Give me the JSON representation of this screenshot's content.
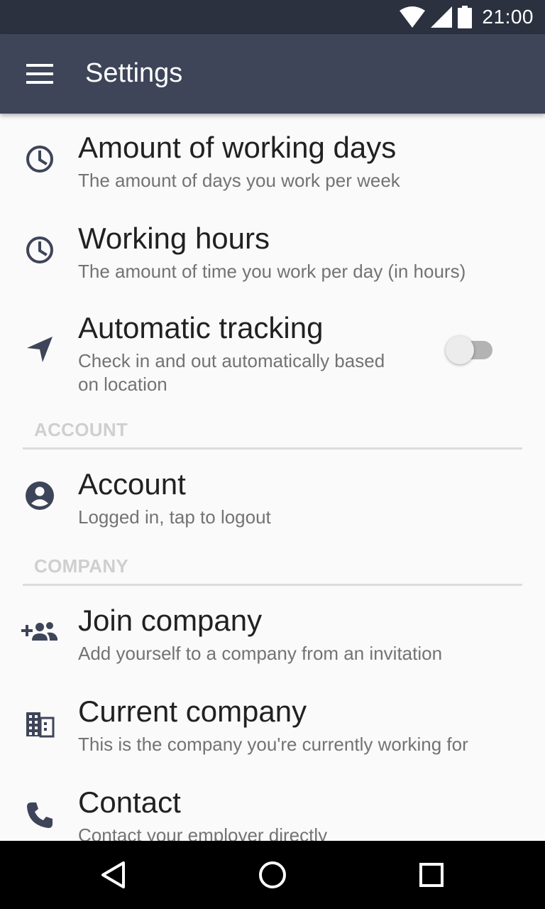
{
  "status_bar": {
    "time": "21:00",
    "icons": [
      "wifi-icon",
      "cell-signal-icon",
      "battery-icon"
    ]
  },
  "app_bar": {
    "title": "Settings",
    "menu_icon": "hamburger-menu-icon"
  },
  "preferences": [
    {
      "icon": "clock-icon",
      "title": "Amount of working days",
      "summary": "The amount of days you work per week"
    },
    {
      "icon": "clock-icon",
      "title": "Working hours",
      "summary": "The amount of time you work per day (in hours)"
    },
    {
      "icon": "navigation-arrow-icon",
      "title": "Automatic tracking",
      "summary_lines": [
        "Check in and out automatically based",
        "on location"
      ],
      "toggle": {
        "state": "off"
      }
    }
  ],
  "sections": [
    {
      "header": "ACCOUNT",
      "items": [
        {
          "icon": "account-circle-icon",
          "title": "Account",
          "summary": "Logged in, tap to logout"
        }
      ]
    },
    {
      "header": "COMPANY",
      "items": [
        {
          "icon": "group-add-icon",
          "title": "Join company",
          "summary": "Add yourself to a company from an invitation"
        },
        {
          "icon": "business-building-icon",
          "title": "Current company",
          "summary": "This is the company you're currently working for"
        },
        {
          "icon": "phone-icon",
          "title": "Contact",
          "summary": "Contact your employer directly"
        }
      ]
    }
  ],
  "nav_bar": {
    "buttons": [
      "back-triangle-icon",
      "home-circle-icon",
      "recents-square-icon"
    ]
  },
  "colors": {
    "status_bar": "#2c3140",
    "app_bar": "#3e4559",
    "icon": "#3e4559",
    "background": "#fafafa"
  }
}
